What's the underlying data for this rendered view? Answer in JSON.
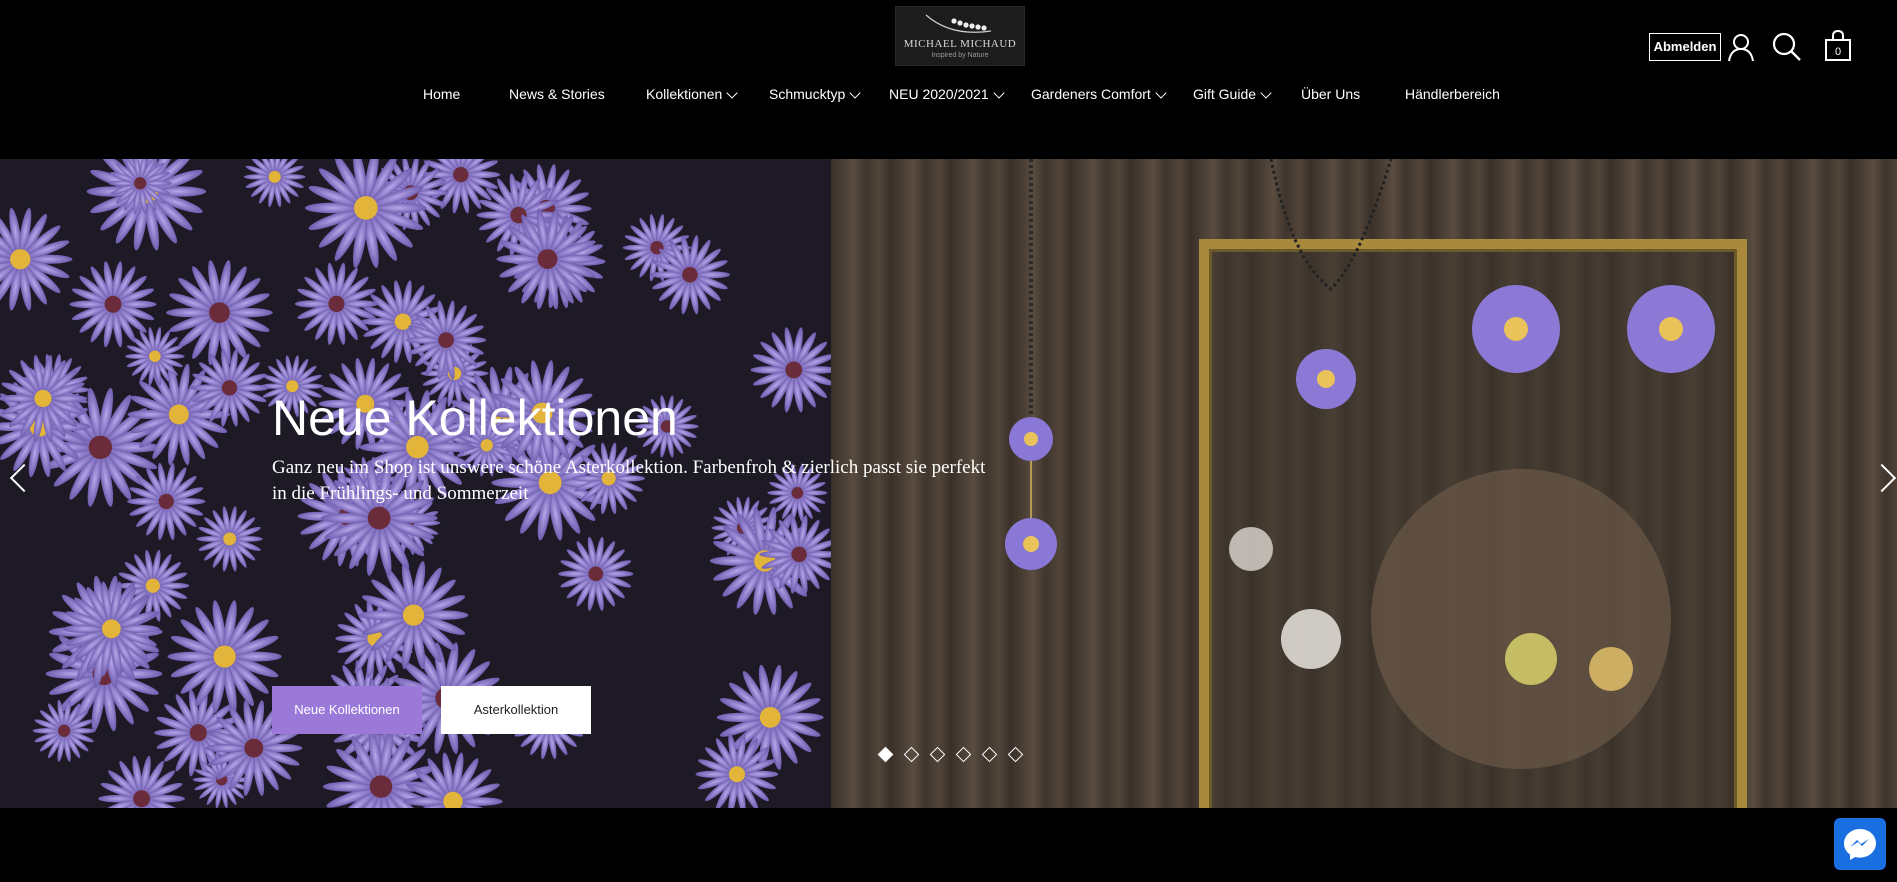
{
  "brand": {
    "name": "MICHAEL MICHAUD",
    "tagline": "Inspired by Nature"
  },
  "nav": {
    "items": [
      {
        "label": "Home",
        "dropdown": false
      },
      {
        "label": "News & Stories",
        "dropdown": false
      },
      {
        "label": "Kollektionen",
        "dropdown": true
      },
      {
        "label": "Schmucktyp",
        "dropdown": true
      },
      {
        "label": "NEU 2020/2021",
        "dropdown": true
      },
      {
        "label": "Gardeners Comfort",
        "dropdown": true
      },
      {
        "label": "Gift Guide",
        "dropdown": true
      },
      {
        "label": "Über Uns",
        "dropdown": false
      },
      {
        "label": "Händlerbereich",
        "dropdown": false
      }
    ]
  },
  "header_actions": {
    "account_label": "Abmelden",
    "icons": [
      "user-icon",
      "search-icon",
      "bag-icon"
    ],
    "cart_count": "0"
  },
  "hero": {
    "title": "Neue Kollektionen",
    "text": "Ganz neu im Shop ist unswere schöne Asterkollektion. Farbenfroh & zierlich passt sie perfekt in die Frühlings- und Sommerzeit",
    "primary_button": "Neue Kollektionen",
    "secondary_button": "Asterkollektion",
    "slide_count": 6,
    "active_slide": 1
  },
  "colors": {
    "header_bg": "#000000",
    "accent": "#9b79d8",
    "messenger": "#1a6fe0"
  }
}
